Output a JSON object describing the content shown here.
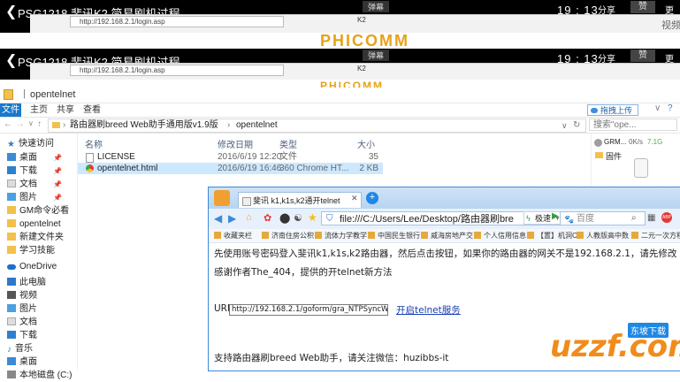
{
  "video": {
    "title": "PSG1218 斐讯K2 简易刷机过程",
    "time": "19 : 13",
    "share": "分享",
    "collect": "赞",
    "more": "更多",
    "danmu": "弹幕",
    "side_text": "视频",
    "browser_url": "http://192.168.2.1/login.asp",
    "browser_tab": "K2",
    "logo": "PHICOMM"
  },
  "explorer": {
    "window_title": "opentelnet",
    "ribbon_tabs": [
      "文件",
      "主页",
      "共享",
      "查看"
    ],
    "upload_button": "拖拽上传",
    "breadcrumb": [
      "路由器刷breed Web助手通用版v1.9版",
      "opentelnet"
    ],
    "search_placeholder": "搜索\"ope...",
    "nav_items": [
      "快速访问",
      "桌面",
      "下载",
      "文档",
      "图片",
      "GM命令必看",
      "opentelnet",
      "新建文件夹",
      "学习技能",
      "OneDrive",
      "此电脑",
      "视频",
      "图片",
      "文档",
      "下载",
      "音乐",
      "桌面",
      "本地磁盘 (C:)"
    ],
    "columns": {
      "name": "名称",
      "date": "修改日期",
      "type": "类型",
      "size": "大小"
    },
    "files": [
      {
        "name": "LICENSE",
        "date": "2016/6/19 12:20",
        "type": "文件",
        "size": "35 KB"
      },
      {
        "name": "opentelnet.html",
        "date": "2016/6/19 16:46",
        "type": "360 Chrome HT...",
        "size": "2 KB"
      }
    ],
    "right_panel": {
      "item": "GRM...",
      "speed": "0K/s",
      "speed2": "7.1G",
      "folder": "固件"
    }
  },
  "browser": {
    "tab_title": "斐讯 k1,k1s,k2通开telnet",
    "address": "file:///C:/Users/Lee/Desktop/路由器刷bre",
    "speed_label": "极速",
    "search_placeholder": "百度",
    "favorites": [
      "收藏夹栏",
      "济南住房公积",
      "流体力学教学",
      "中国民生银行",
      "威海房地产交",
      "个人信用信息",
      "【置】机洞C",
      "人教版高中数",
      "二元一次方程"
    ],
    "intro": "先使用账号密码登入斐讯k1,k1s,k2路由器，然后点击按钮，如果你的路由器的网关不是192.168.2.1，请先修改下面的表单。",
    "thanks": "感谢作者The_404，提供的开telnet新方法",
    "url_label": "URL:",
    "url_value": "http://192.168.2.1/goform/gra_NTPSyncWithLocal",
    "open_link": "开启telnet服务",
    "footer": "支持路由器刷breed Web助手，请关注微信：huzibbs-it"
  },
  "watermark": {
    "domain": "uzzf.com",
    "brand": "东坡下载"
  }
}
